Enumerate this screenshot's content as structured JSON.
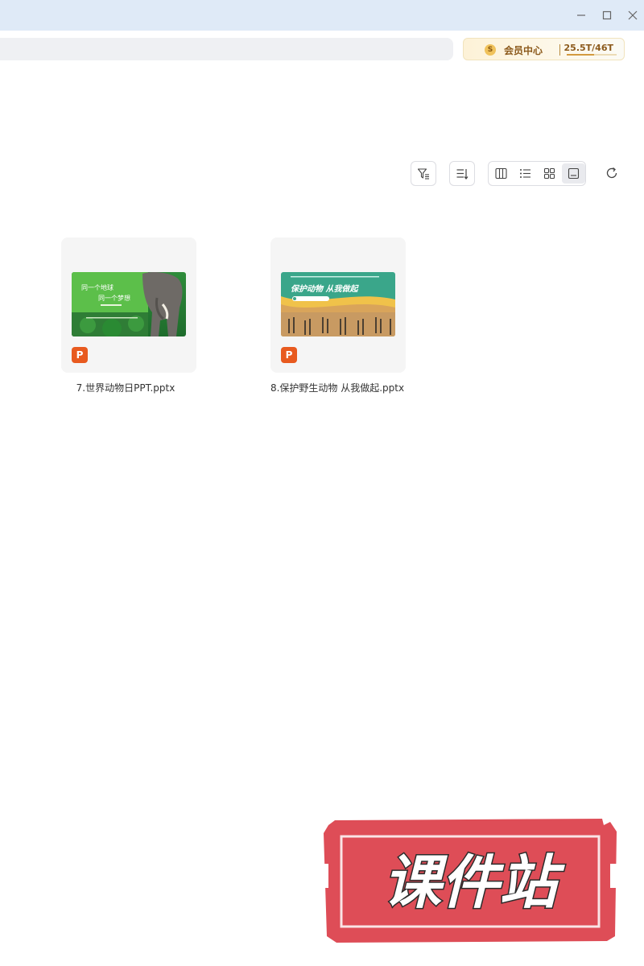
{
  "window": {
    "minimize_icon": "minimize-icon",
    "maximize_icon": "maximize-icon",
    "close_icon": "close-icon"
  },
  "vip": {
    "coin": "S",
    "label": "会员中心",
    "storage": "25.5T/46T",
    "storage_fraction": 0.554,
    "accent": "#d39a3f"
  },
  "toolbar": {
    "filter_icon": "filter-icon",
    "sort_icon": "sort-icon",
    "views": [
      "column-view-icon",
      "list-view-icon",
      "grid-view-icon",
      "preview-view-icon"
    ],
    "active_view": 3,
    "refresh_icon": "refresh-icon"
  },
  "files": [
    {
      "name": "7.世界动物日PPT.pptx",
      "thumb_title_1": "同一个地球",
      "thumb_title_2": "同一个梦想",
      "badge": "P"
    },
    {
      "name": "8.保护野生动物 从我做起.pptx",
      "thumb_title_1": "保护动物 从我做起",
      "badge": "P"
    }
  ],
  "watermark": {
    "text": "课件站",
    "color": "#de4d57"
  }
}
